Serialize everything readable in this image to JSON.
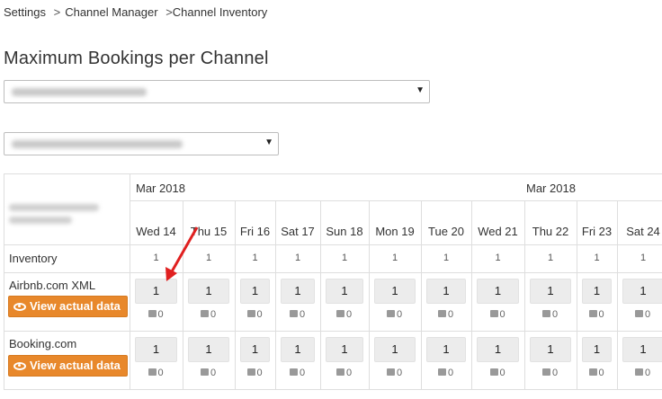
{
  "breadcrumb": [
    {
      "label": "Settings"
    },
    {
      "label": "Channel Manager"
    },
    {
      "label": "Channel Inventory"
    }
  ],
  "page_title": "Maximum Bookings per Channel",
  "colors": {
    "accent": "#e8882b",
    "grid_line": "#dedede",
    "input_bg": "#ececec",
    "arrow": "#e02020"
  },
  "table": {
    "months": [
      {
        "label": "Mar 2018"
      },
      {
        "label": "Mar 2018"
      }
    ],
    "days": [
      "Wed 14",
      "Thu 15",
      "Fri 16",
      "Sat 17",
      "Sun 18",
      "Mon 19",
      "Tue 20",
      "Wed 21",
      "Thu 22",
      "Fri 23",
      "Sat 24"
    ],
    "inventory_label": "Inventory",
    "inventory": [
      "1",
      "1",
      "1",
      "1",
      "1",
      "1",
      "1",
      "1",
      "1",
      "1",
      "1"
    ],
    "channels": [
      {
        "name": "Airbnb.com XML",
        "button_label": "View actual data",
        "max": [
          "1",
          "1",
          "1",
          "1",
          "1",
          "1",
          "1",
          "1",
          "1",
          "1",
          "1"
        ],
        "booked": [
          "0",
          "0",
          "0",
          "0",
          "0",
          "0",
          "0",
          "0",
          "0",
          "0",
          "0"
        ]
      },
      {
        "name": "Booking.com",
        "button_label": "View actual data",
        "max": [
          "1",
          "1",
          "1",
          "1",
          "1",
          "1",
          "1",
          "1",
          "1",
          "1",
          "1"
        ],
        "booked": [
          "0",
          "0",
          "0",
          "0",
          "0",
          "0",
          "0",
          "0",
          "0",
          "0",
          "0"
        ]
      }
    ]
  },
  "icons": {
    "view_button": "eye-icon",
    "booked": "suitcase-icon",
    "select": "caret-down-icon"
  }
}
